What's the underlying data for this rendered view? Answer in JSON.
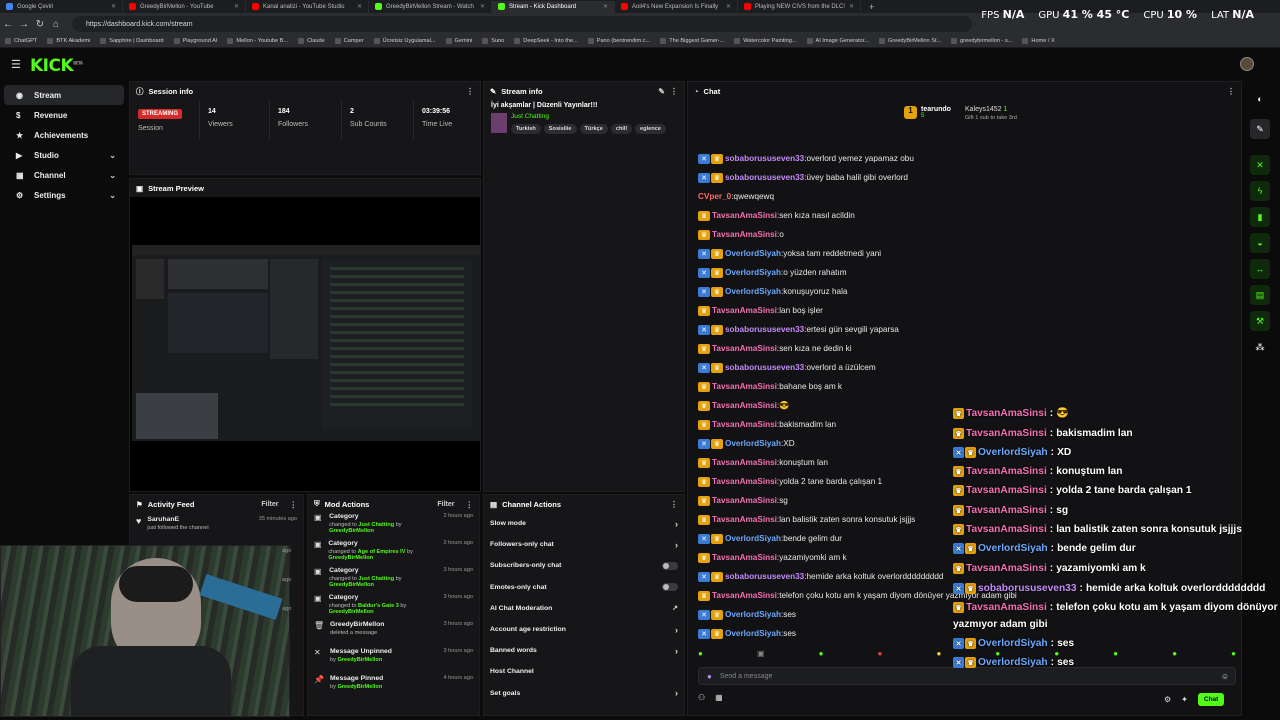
{
  "browser": {
    "tabs": [
      {
        "title": "Google Çeviri",
        "color": "#4285f4"
      },
      {
        "title": "GreedyBirMellon - YouTube",
        "color": "#ff0000"
      },
      {
        "title": "Kanal analizi - YouTube Studio",
        "color": "#ff0000"
      },
      {
        "title": "GreedyBirMellon Stream - Watch",
        "color": "#53fc18"
      },
      {
        "title": "Stream - Kick Dashboard",
        "color": "#53fc18"
      },
      {
        "title": "Aoil4's New Expansion Is Finally",
        "color": "#ff0000"
      },
      {
        "title": "Playing NEW CIVS from the DLC!",
        "color": "#ff0000"
      }
    ],
    "url": "https://dashboard.kick.com/stream",
    "bookmarks": [
      "ChatGPT",
      "BTK Akademi",
      "Sapphire | Dashboard",
      "Playground AI",
      "Mellon - Youtube B...",
      "Claude",
      "Camper",
      "Ücretsiz Uygulamal...",
      "Gemini",
      "Suno",
      "DeepSeek - Into the...",
      "Pano (bentrendim.c...",
      "The Biggest Gamer-...",
      "Watercolor Painting...",
      "AI Image Generator...",
      "GreedyBirMellon St...",
      "greedybirmellon - s...",
      "Home / X"
    ]
  },
  "hud": {
    "fps_label": "FPS",
    "fps_value": "N/A",
    "gpu_label": "GPU",
    "gpu_value": "41 % 45 °C",
    "cpu_label": "CPU",
    "cpu_value": "10 %",
    "lat_label": "LAT",
    "lat_value": "N/A"
  },
  "app": {
    "logo": "KICK",
    "logo_sup": "BETA"
  },
  "sidebar": {
    "items": [
      {
        "label": "Stream",
        "icon": "stream-icon",
        "active": true
      },
      {
        "label": "Revenue",
        "icon": "revenue-icon"
      },
      {
        "label": "Achievements",
        "icon": "achievements-icon"
      },
      {
        "label": "Studio",
        "icon": "studio-icon",
        "chevron": true
      },
      {
        "label": "Channel",
        "icon": "channel-icon",
        "chevron": true
      },
      {
        "label": "Settings",
        "icon": "settings-icon",
        "chevron": true
      }
    ]
  },
  "session": {
    "title": "Session info",
    "status": "STREAMING",
    "status_label": "Session",
    "stats": [
      {
        "value": "14",
        "label": "Viewers"
      },
      {
        "value": "184",
        "label": "Followers"
      },
      {
        "value": "2",
        "label": "Sub Counts"
      },
      {
        "value": "03:39:56",
        "label": "Time Live"
      }
    ]
  },
  "preview": {
    "title": "Stream Preview"
  },
  "streaminfo": {
    "title": "Stream info",
    "stream_title": "İyi akşamlar | Düzenli Yayınlar!!!",
    "category": "Just Chatting",
    "tags": [
      "Turkish",
      "Sosisliie",
      "Türkçe",
      "chill",
      "eglence"
    ]
  },
  "activity": {
    "title": "Activity Feed",
    "filter": "Filter",
    "items": [
      {
        "user": "SaruhanE",
        "text": "just followed the channel",
        "time": "35 minutes ago"
      }
    ],
    "extra_times": [
      "ago",
      "ago",
      "ago"
    ]
  },
  "mod": {
    "title": "Mod Actions",
    "filter": "Filter",
    "items": [
      {
        "title": "Category",
        "pre": "changed to ",
        "value": "Just Chatting",
        "by": "GreedyBirMellon",
        "time": "2 hours ago",
        "icon": "category-icon"
      },
      {
        "title": "Category",
        "pre": "changed to ",
        "value": "Age of Empires IV",
        "by": "GreedyBirMellon",
        "time": "2 hours ago",
        "icon": "category-icon"
      },
      {
        "title": "Category",
        "pre": "changed to ",
        "value": "Just Chatting",
        "by": "GreedyBirMellon",
        "time": "3 hours ago",
        "icon": "category-icon"
      },
      {
        "title": "Category",
        "pre": "changed to ",
        "value": "Baldur's Gate 3",
        "by": "GreedyBirMellon",
        "time": "3 hours ago",
        "icon": "category-icon"
      },
      {
        "title": "GreedyBirMellon",
        "pre": "deleted a message",
        "value": "",
        "by": "",
        "time": "3 hours ago",
        "icon": "trash-icon"
      },
      {
        "title": "Message Unpinned",
        "pre": "",
        "value": "",
        "by": "GreedyBirMellon",
        "time": "3 hours ago",
        "icon": "unpin-icon"
      },
      {
        "title": "Message Pinned",
        "pre": "",
        "value": "",
        "by": "GreedyBirMellon",
        "time": "4 hours ago",
        "icon": "pin-icon"
      }
    ]
  },
  "channel_actions": {
    "title": "Channel Actions",
    "items": [
      {
        "label": "Slow mode",
        "control": "chevron"
      },
      {
        "label": "Followers-only chat",
        "control": "chevron"
      },
      {
        "label": "Subscribers-only chat",
        "control": "toggle"
      },
      {
        "label": "Emotes-only chat",
        "control": "toggle"
      },
      {
        "label": "AI Chat Moderation",
        "control": "external"
      },
      {
        "label": "Account age restriction",
        "control": "chevron"
      },
      {
        "label": "Banned words",
        "control": "chevron"
      },
      {
        "label": "Host Channel",
        "control": "none"
      },
      {
        "label": "Set goals",
        "control": "chevron"
      }
    ]
  },
  "chat": {
    "title": "Chat",
    "gifter": {
      "user": "tearundo",
      "count": "5",
      "user2": "Kaleys1452",
      "count2": "1",
      "gift_text": "Gift 1 sub to take 3rd"
    },
    "messages": [
      {
        "user": "sobaborususeven33",
        "color": "#c58af9",
        "badges": [
          "vip",
          "crown"
        ],
        "text": "overlord yemez yapamaz obu"
      },
      {
        "user": "sobaborususeven33",
        "color": "#c58af9",
        "badges": [
          "vip",
          "crown"
        ],
        "text": "üvey baba halil gibi overlord"
      },
      {
        "user": "CVper_0",
        "color": "#ff6b6b",
        "badges": [],
        "text": "qwewqewq"
      },
      {
        "user": "TavsanAmaSinsi",
        "color": "#f46fb3",
        "badges": [
          "crown"
        ],
        "text": "sen kıza nasıl acildin"
      },
      {
        "user": "TavsanAmaSinsi",
        "color": "#f46fb3",
        "badges": [
          "crown"
        ],
        "text": "o"
      },
      {
        "user": "OverlordSiyah",
        "color": "#6aa8ff",
        "badges": [
          "vip",
          "crown"
        ],
        "text": "yoksa tam reddetmedi yani"
      },
      {
        "user": "OverlordSiyah",
        "color": "#6aa8ff",
        "badges": [
          "vip",
          "crown"
        ],
        "text": "o yüzden rahatım"
      },
      {
        "user": "OverlordSiyah",
        "color": "#6aa8ff",
        "badges": [
          "vip",
          "crown"
        ],
        "text": "konuşuyoruz hala"
      },
      {
        "user": "TavsanAmaSinsi",
        "color": "#f46fb3",
        "badges": [
          "crown"
        ],
        "text": "lan boş işler"
      },
      {
        "user": "sobaborususeven33",
        "color": "#c58af9",
        "badges": [
          "vip",
          "crown"
        ],
        "text": "ertesi gün sevgili yaparsa"
      },
      {
        "user": "TavsanAmaSinsi",
        "color": "#f46fb3",
        "badges": [
          "crown"
        ],
        "text": "sen kıza ne dedin ki"
      },
      {
        "user": "sobaborususeven33",
        "color": "#c58af9",
        "badges": [
          "vip",
          "crown"
        ],
        "text": "overlord a üzülcem"
      },
      {
        "user": "TavsanAmaSinsi",
        "color": "#f46fb3",
        "badges": [
          "crown"
        ],
        "text": "bahane boş am k"
      },
      {
        "user": "TavsanAmaSinsi",
        "color": "#f46fb3",
        "badges": [
          "crown"
        ],
        "text": "😎"
      },
      {
        "user": "TavsanAmaSinsi",
        "color": "#f46fb3",
        "badges": [
          "crown"
        ],
        "text": "bakismadim lan"
      },
      {
        "user": "OverlordSiyah",
        "color": "#6aa8ff",
        "badges": [
          "vip",
          "crown"
        ],
        "text": "XD"
      },
      {
        "user": "TavsanAmaSinsi",
        "color": "#f46fb3",
        "badges": [
          "crown"
        ],
        "text": "konuştum lan"
      },
      {
        "user": "TavsanAmaSinsi",
        "color": "#f46fb3",
        "badges": [
          "crown"
        ],
        "text": "yolda 2 tane barda çalışan 1"
      },
      {
        "user": "TavsanAmaSinsi",
        "color": "#f46fb3",
        "badges": [
          "crown"
        ],
        "text": "sg"
      },
      {
        "user": "TavsanAmaSinsi",
        "color": "#f46fb3",
        "badges": [
          "crown"
        ],
        "text": "lan balistik zaten sonra konsutuk jsjjjs"
      },
      {
        "user": "OverlordSiyah",
        "color": "#6aa8ff",
        "badges": [
          "vip",
          "crown"
        ],
        "text": "bende gelim dur"
      },
      {
        "user": "TavsanAmaSinsi",
        "color": "#f46fb3",
        "badges": [
          "crown"
        ],
        "text": "yazamiyomki am k"
      },
      {
        "user": "sobaborususeven33",
        "color": "#c58af9",
        "badges": [
          "vip",
          "crown"
        ],
        "text": "hemide arka koltuk overlorddddddddd"
      },
      {
        "user": "TavsanAmaSinsi",
        "color": "#f46fb3",
        "badges": [
          "crown"
        ],
        "text": "telefon çoku kotu am k yaşam diyom dönüyer yazmıyor adam gibi"
      },
      {
        "user": "OverlordSiyah",
        "color": "#6aa8ff",
        "badges": [
          "vip",
          "crown"
        ],
        "text": "ses"
      },
      {
        "user": "OverlordSiyah",
        "color": "#6aa8ff",
        "badges": [
          "vip",
          "crown"
        ],
        "text": "ses"
      }
    ],
    "input_placeholder": "Send a message",
    "send_label": "Chat"
  },
  "overlay": {
    "messages": [
      {
        "user": "TavsanAmaSinsi",
        "color": "#f46fb3",
        "badges": [
          "crown"
        ],
        "text": "😎"
      },
      {
        "user": "TavsanAmaSinsi",
        "color": "#f46fb3",
        "badges": [
          "crown"
        ],
        "text": "bakismadim lan"
      },
      {
        "user": "OverlordSiyah",
        "color": "#6aa8ff",
        "badges": [
          "vip",
          "crown"
        ],
        "text": "XD"
      },
      {
        "user": "TavsanAmaSinsi",
        "color": "#f46fb3",
        "badges": [
          "crown"
        ],
        "text": "konuştum lan"
      },
      {
        "user": "TavsanAmaSinsi",
        "color": "#f46fb3",
        "badges": [
          "crown"
        ],
        "text": "yolda 2 tane barda çalışan 1"
      },
      {
        "user": "TavsanAmaSinsi",
        "color": "#f46fb3",
        "badges": [
          "crown"
        ],
        "text": "sg"
      },
      {
        "user": "TavsanAmaSinsi",
        "color": "#f46fb3",
        "badges": [
          "crown"
        ],
        "text": "lan balistik zaten sonra konsutuk jsjjjs"
      },
      {
        "user": "OverlordSiyah",
        "color": "#6aa8ff",
        "badges": [
          "vip",
          "crown"
        ],
        "text": "bende gelim dur"
      },
      {
        "user": "TavsanAmaSinsi",
        "color": "#f46fb3",
        "badges": [
          "crown"
        ],
        "text": "yazamiyomki am k"
      },
      {
        "user": "sobaborususeven33",
        "color": "#c58af9",
        "badges": [
          "vip",
          "crown"
        ],
        "text": "hemide arka koltuk overlordddddddd"
      },
      {
        "user": "TavsanAmaSinsi",
        "color": "#f46fb3",
        "badges": [
          "crown"
        ],
        "text": "telefon çoku kotu am k yaşam diyom dönüyor"
      },
      {
        "user": "",
        "color": "#fff",
        "badges": [],
        "text": "yazmıyor adam gibi"
      },
      {
        "user": "OverlordSiyah",
        "color": "#6aa8ff",
        "badges": [
          "vip",
          "crown"
        ],
        "text": "ses"
      },
      {
        "user": "OverlordSiyah",
        "color": "#6aa8ff",
        "badges": [
          "vip",
          "crown"
        ],
        "text": "ses"
      }
    ]
  },
  "colors": {
    "accent": "#53fc18",
    "streaming": "#d42a2a",
    "panel": "#161618"
  }
}
